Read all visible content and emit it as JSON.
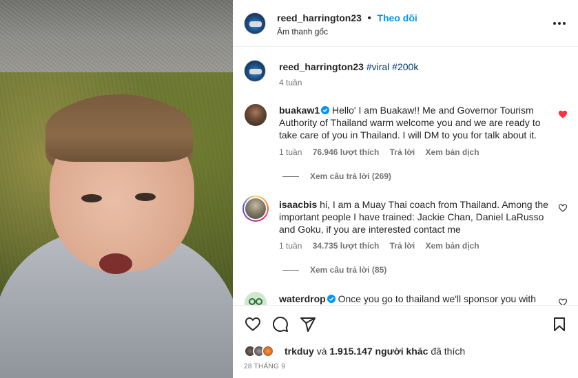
{
  "header": {
    "username": "reed_harrington23",
    "separator": "•",
    "follow_label": "Theo dõi",
    "audio_label": "Âm thanh gốc",
    "more_icon": "more-horizontal-icon"
  },
  "caption": {
    "username": "reed_harrington23",
    "hashtags": "#viral #200k",
    "time": "4 tuần"
  },
  "comments": [
    {
      "username": "buakaw1",
      "verified": true,
      "text": "Hello' I am Buakaw!! Me and Governor Tourism Authority of Thailand warm welcome you and we are ready to take care of you in Thailand. I will DM to you for talk about it.",
      "time": "1 tuần",
      "likes": "76.946 lượt thích",
      "reply_label": "Trả lời",
      "translate_label": "Xem bản dịch",
      "view_replies": "Xem câu trả lời (269)",
      "liked": true
    },
    {
      "username": "isaacbis",
      "verified": false,
      "text": "hi, I am a Muay Thai coach from Thailand. Among the important people I have trained: Jackie Chan, Daniel LaRusso and Goku, if you are interested contact me",
      "time": "1 tuần",
      "likes": "34.735 lượt thích",
      "reply_label": "Trả lời",
      "translate_label": "Xem bản dịch",
      "view_replies": "Xem câu trả lời (85)",
      "liked": false
    },
    {
      "username": "waterdrop",
      "verified": true,
      "text": "Once you go to thailand we'll sponsor you with",
      "liked": false
    }
  ],
  "footer": {
    "liked_by_user": "trkduy",
    "liked_connector": "và",
    "liked_count": "1.915.147 người khác",
    "liked_suffix": "đã thích",
    "date": "28 THÁNG 9"
  },
  "colors": {
    "accent": "#0095f6",
    "verified": "#0095f6",
    "liked_heart": "#ff3040",
    "text": "#262626",
    "muted": "#737373"
  }
}
